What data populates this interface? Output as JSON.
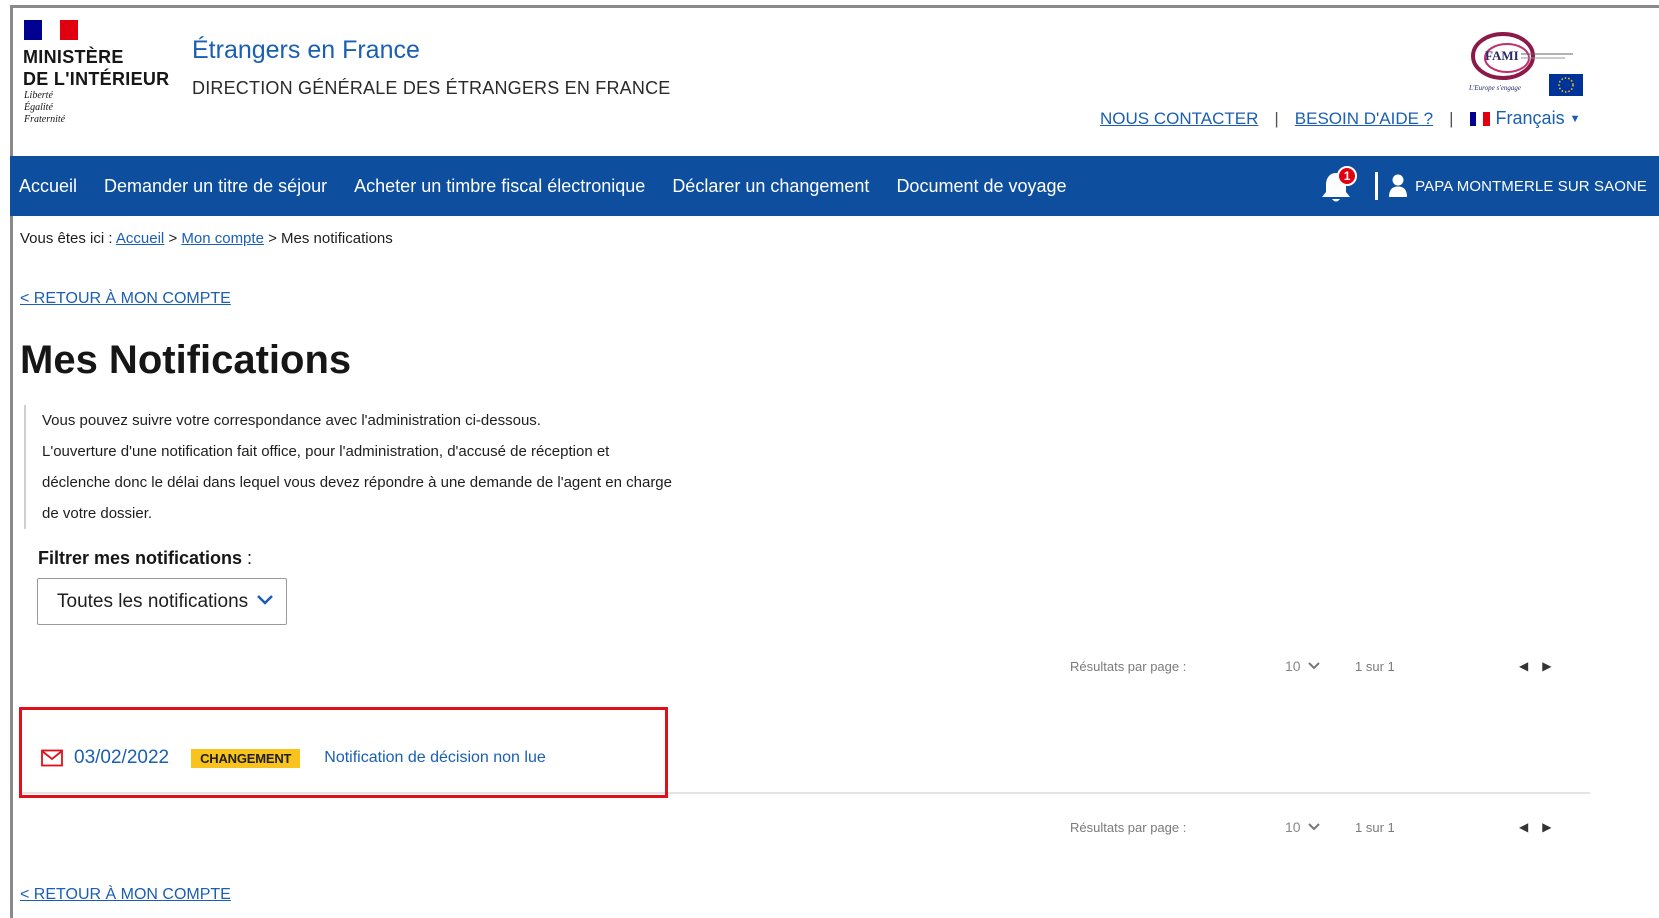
{
  "header": {
    "ministry_line1": "MINISTÈRE",
    "ministry_line2": "DE L'INTÉRIEUR",
    "motto_1": "Liberté",
    "motto_2": "Égalité",
    "motto_3": "Fraternité",
    "site_title": "Étrangers en France",
    "site_subtitle": "DIRECTION GÉNÉRALE DES ÉTRANGERS EN FRANCE",
    "partner_logo_text": "FAMI",
    "partner_logo_caption": "L'Europe s'engage",
    "contact_link": "NOUS CONTACTER",
    "help_link": "BESOIN D'AIDE ?",
    "separator": "|",
    "language": "Français",
    "flag_colors": [
      "#000091",
      "#ffffff",
      "#e1000f"
    ]
  },
  "nav": {
    "items": [
      {
        "label": "Accueil"
      },
      {
        "label": "Demander un titre de séjour"
      },
      {
        "label": "Acheter un timbre fiscal électronique"
      },
      {
        "label": "Déclarer un changement"
      },
      {
        "label": "Document de voyage"
      }
    ],
    "notification_count": "1",
    "user_name": "PAPA MONTMERLE SUR SAONE",
    "background": "#0d4f9e"
  },
  "breadcrumb": {
    "prefix": "Vous êtes ici :",
    "home": "Accueil",
    "sep1": ">",
    "account": "Mon compte",
    "sep2": ">",
    "current": "Mes notifications"
  },
  "back_link": "< RETOUR À MON COMPTE",
  "page_title": "Mes Notifications",
  "info": {
    "line1": "Vous pouvez suivre votre correspondance avec l'administration ci-dessous.",
    "line2": "L'ouverture d'une notification fait office, pour l'administration, d'accusé de réception et",
    "line3": "déclenche donc le délai dans lequel vous devez répondre à une demande de l'agent en charge",
    "line4": "de votre dossier."
  },
  "filter": {
    "label": "Filtrer mes notifications",
    "label_suffix": " :",
    "selected": "Toutes les notifications"
  },
  "pagination": {
    "per_page_label": "Résultats par page :",
    "per_page_value": "10",
    "page_info": "1 sur 1",
    "prev_icon": "caret-left-icon",
    "next_icon": "caret-right-icon"
  },
  "notifications": [
    {
      "date": "03/02/2022",
      "tag": "CHANGEMENT",
      "title": "Notification de décision non lue",
      "icon": "envelope-icon"
    }
  ],
  "colors": {
    "link": "#1a5fb4",
    "tag": "#f7c31c",
    "highlight": "#e0101a"
  }
}
